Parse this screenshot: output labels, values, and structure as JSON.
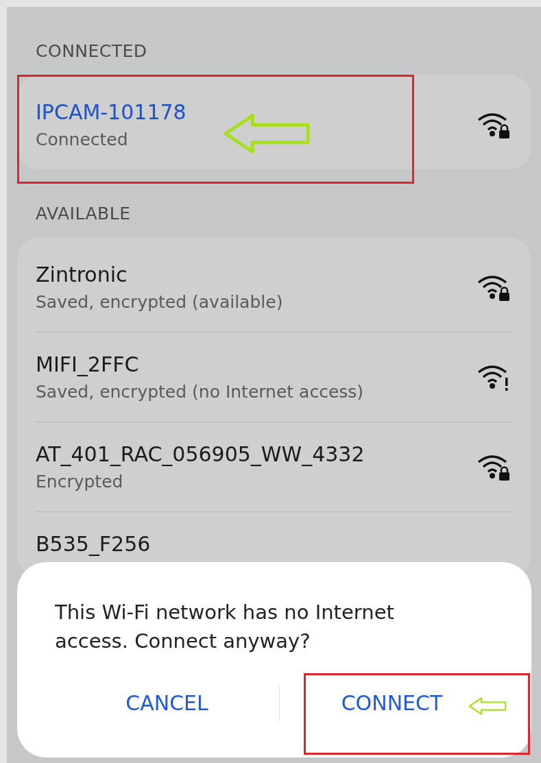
{
  "sections": [
    {
      "title": "CONNECTED",
      "networks": [
        {
          "name": "IPCAM-101178",
          "status": "Connected",
          "active": true,
          "kind": "locked",
          "annotated": true
        }
      ]
    },
    {
      "title": "AVAILABLE",
      "networks": [
        {
          "name": "Zintronic",
          "status": "Saved, encrypted (available)",
          "active": false,
          "kind": "locked",
          "annotated": false
        },
        {
          "name": "MIFI_2FFC",
          "status": "Saved, encrypted (no Internet access)",
          "active": false,
          "kind": "alert",
          "annotated": false
        },
        {
          "name": "AT_401_RAC_056905_WW_4332",
          "status": "Encrypted",
          "active": false,
          "kind": "locked",
          "annotated": false
        },
        {
          "name": "B535_F256",
          "active": false,
          "annotated": false
        }
      ]
    }
  ],
  "dialog": {
    "message": "This Wi-Fi network has no Internet access. Connect anyway?",
    "buttons": [
      {
        "label": "CANCEL",
        "annotated": false
      },
      {
        "label": "CONNECT",
        "annotated": true
      }
    ]
  }
}
